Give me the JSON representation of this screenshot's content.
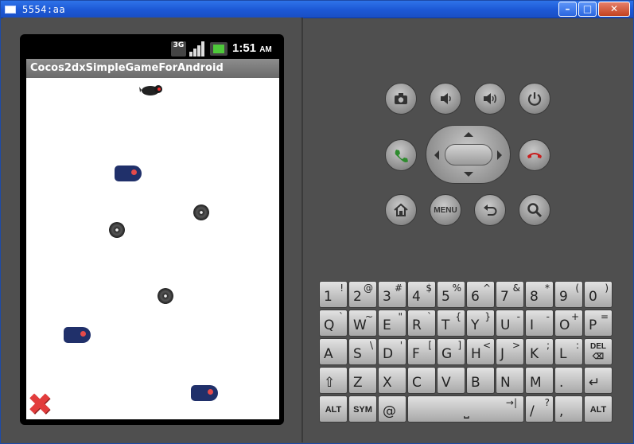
{
  "window": {
    "title": "5554:aa",
    "min_label": "–",
    "max_label": "□",
    "close_label": "✕"
  },
  "status_bar": {
    "network": "3G",
    "time": "1:51",
    "ampm": "AM"
  },
  "app": {
    "title": "Cocos2dxSimpleGameForAndroid"
  },
  "game": {
    "player": "player-ninja-sprite",
    "enemies": [
      "ghost-monster",
      "ghost-monster",
      "ghost-monster"
    ],
    "projectiles": [
      "shuriken",
      "shuriken",
      "shuriken"
    ],
    "quit_icon": "✖"
  },
  "controls": {
    "camera": "camera-icon",
    "volume_down": "volume-down-icon",
    "volume_up": "volume-up-icon",
    "power": "power-icon",
    "call": "call-icon",
    "end_call": "end-call-icon",
    "home": "home-icon",
    "menu_label": "MENU",
    "back": "back-icon",
    "search": "search-icon",
    "colors": {
      "call": "#2e8b2e",
      "end_call": "#c81e1e"
    }
  },
  "keyboard": {
    "row1": [
      {
        "main": "1",
        "alt": "!"
      },
      {
        "main": "2",
        "alt": "@"
      },
      {
        "main": "3",
        "alt": "#"
      },
      {
        "main": "4",
        "alt": "$"
      },
      {
        "main": "5",
        "alt": "%"
      },
      {
        "main": "6",
        "alt": "^"
      },
      {
        "main": "7",
        "alt": "&"
      },
      {
        "main": "8",
        "alt": "*"
      },
      {
        "main": "9",
        "alt": "("
      },
      {
        "main": "0",
        "alt": ")"
      }
    ],
    "row2": [
      {
        "main": "Q",
        "alt": "`"
      },
      {
        "main": "W",
        "alt": "~"
      },
      {
        "main": "E",
        "alt": "\""
      },
      {
        "main": "R",
        "alt": "`"
      },
      {
        "main": "T",
        "alt": "{"
      },
      {
        "main": "Y",
        "alt": "}"
      },
      {
        "main": "U",
        "alt": "-"
      },
      {
        "main": "I",
        "alt": "-"
      },
      {
        "main": "O",
        "alt": "+"
      },
      {
        "main": "P",
        "alt": "="
      }
    ],
    "row3": [
      {
        "main": "A",
        "alt": ""
      },
      {
        "main": "S",
        "alt": "\\"
      },
      {
        "main": "D",
        "alt": "'"
      },
      {
        "main": "F",
        "alt": "["
      },
      {
        "main": "G",
        "alt": "]"
      },
      {
        "main": "H",
        "alt": "<"
      },
      {
        "main": "J",
        "alt": ">"
      },
      {
        "main": "K",
        "alt": ";"
      },
      {
        "main": "L",
        "alt": ":"
      },
      {
        "main": "DEL",
        "alt": ""
      }
    ],
    "row4": [
      {
        "main": "⇧",
        "alt": ""
      },
      {
        "main": "Z",
        "alt": ""
      },
      {
        "main": "X",
        "alt": ""
      },
      {
        "main": "C",
        "alt": ""
      },
      {
        "main": "V",
        "alt": ""
      },
      {
        "main": "B",
        "alt": ""
      },
      {
        "main": "N",
        "alt": ""
      },
      {
        "main": "M",
        "alt": ""
      },
      {
        "main": ".",
        "alt": ""
      },
      {
        "main": "↵",
        "alt": ""
      }
    ],
    "row5": {
      "alt_left": "ALT",
      "sym": "SYM",
      "at": "@",
      "space": "⎵",
      "tab": "→|",
      "slash": "/",
      "question": "?",
      "comma": ",",
      "alt_right": "ALT"
    }
  }
}
